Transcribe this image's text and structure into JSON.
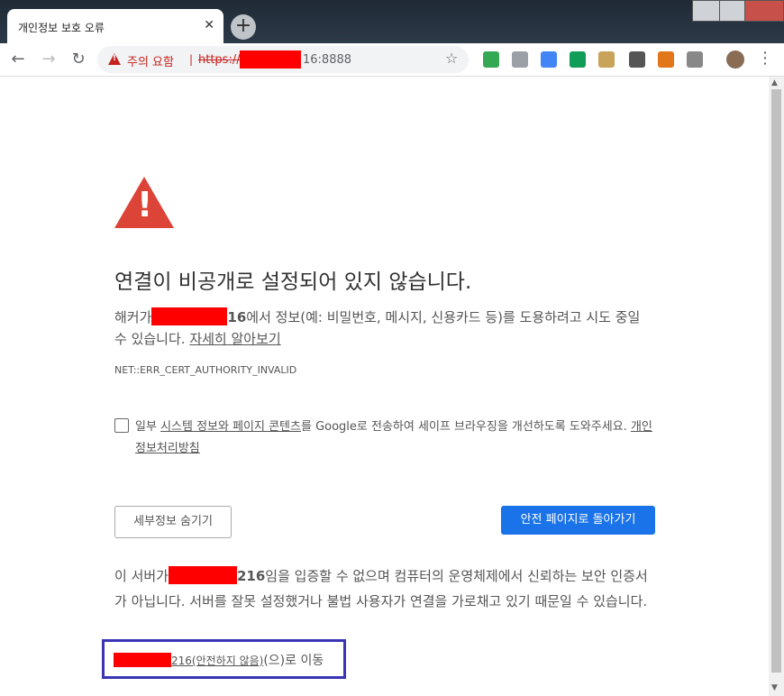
{
  "browser": {
    "tab_title": "개인정보 보호 오류",
    "tab_close": "✕",
    "new_tab": "+",
    "security_label": "주의 요함",
    "separator": "|",
    "url_scheme": "https://",
    "url_rest": "16:8888",
    "back": "←",
    "forward": "→",
    "reload": "↻",
    "star": "☆",
    "menu": "⋮"
  },
  "page": {
    "heading": "연결이 비공개로 설정되어 있지 않습니다.",
    "intro_prefix": "해커가",
    "intro_host_suffix": "16",
    "intro_body": "에서 정보(예: 비밀번호, 메시지, 신용카드 등)를 도용하려고 시도 중일 수 있습니다. ",
    "learn_more": "자세히 알아보기",
    "error_code": "NET::ERR_CERT_AUTHORITY_INVALID",
    "report_prefix": "일부 ",
    "report_link": "시스템 정보와 페이지 콘텐츠",
    "report_body": "를 Google로 전송하여 세이프 브라우징을 개선하도록 도와주세요. ",
    "privacy_link": "개인정보처리방침",
    "details_button": "세부정보 숨기기",
    "back_button": "안전 페이지로 돌아가기",
    "details_prefix": "이 서버가",
    "details_host_suffix": "216",
    "details_body": "임을 입증할 수 없으며 컴퓨터의 운영체제에서 신뢰하는 보안 인증서가 아닙니다. 서버를 잘못 설정했거나 불법 사용자가 연결을 가로채고 있기 때문일 수 있습니다.",
    "proceed_host_suffix": "216",
    "proceed_link": "(안전하지 않음)",
    "proceed_suffix": "(으)로 이동"
  }
}
